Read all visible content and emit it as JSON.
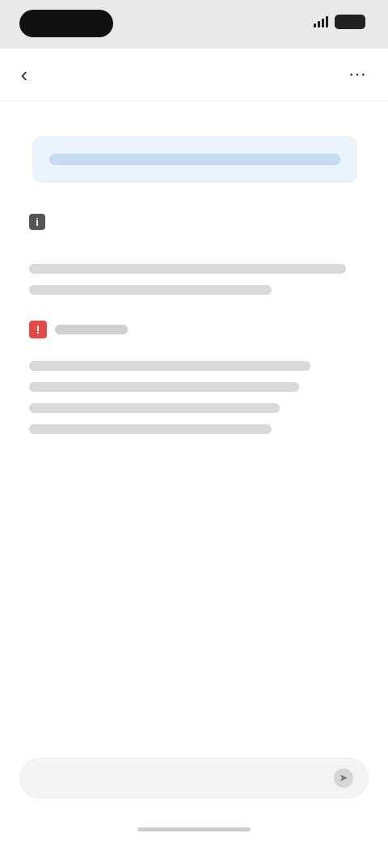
{
  "status_bar": {
    "time": "",
    "battery": ""
  },
  "nav": {
    "title": ""
  },
  "banner": {
    "text": ""
  },
  "section": {
    "label": ""
  },
  "warning": {
    "label": ""
  },
  "input": {
    "placeholder": ""
  },
  "icons": {
    "back": "chevron-left-icon",
    "more": "more-icon",
    "info": "info-icon",
    "warning": "warning-icon",
    "send": "send-icon"
  },
  "colors": {
    "status_bar_bg": "#e9e9e9",
    "banner_bg": "#eaf2fc",
    "banner_accent": "#c6dcf5",
    "warning_red": "#e14a4a"
  }
}
